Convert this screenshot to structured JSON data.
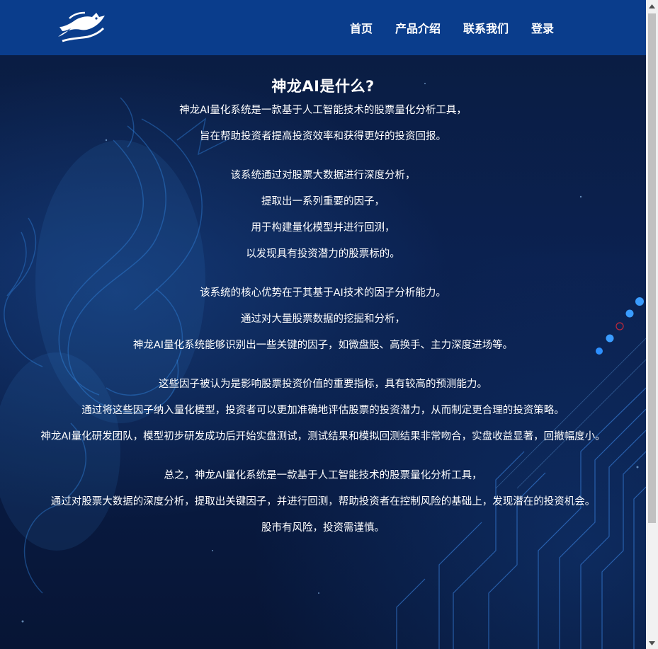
{
  "nav": {
    "logo_name": "dragon-logo",
    "items": [
      {
        "label": "首页"
      },
      {
        "label": "产品介绍"
      },
      {
        "label": "联系我们"
      },
      {
        "label": "登录"
      }
    ]
  },
  "main": {
    "title": "神龙AI是什么?",
    "paragraphs": [
      "神龙AI量化系统是一款基于人工智能技术的股票量化分析工具，",
      "旨在帮助投资者提高投资效率和获得更好的投资回报。",
      "该系统通过对股票大数据进行深度分析，",
      "提取出一系列重要的因子，",
      "用于构建量化模型并进行回测，",
      "以发现具有投资潜力的股票标的。",
      "该系统的核心优势在于其基于AI技术的因子分析能力。",
      "通过对大量股票数据的挖掘和分析，",
      "神龙AI量化系统能够识别出一些关键的因子，如微盘股、高换手、主力深度进场等。",
      "这些因子被认为是影响股票投资价值的重要指标，具有较高的预测能力。",
      "通过将这些因子纳入量化模型，投资者可以更加准确地评估股票的投资潜力，从而制定更合理的投资策略。",
      "神龙AI量化研发团队，模型初步研发成功后开始实盘测试，测试结果和模拟回测结果非常吻合，实盘收益显著，回撤幅度小。",
      "总之，神龙AI量化系统是一款基于人工智能技术的股票量化分析工具，",
      "通过对股票大数据的深度分析，提取出关键因子，并进行回测，帮助投资者在控制风险的基础上，发现潜在的投资机会。",
      "股市有风险，投资需谨慎。"
    ]
  },
  "colors": {
    "header_bg": "#0a3d8c",
    "page_bg": "#0b1f45",
    "text": "#ffffff"
  }
}
